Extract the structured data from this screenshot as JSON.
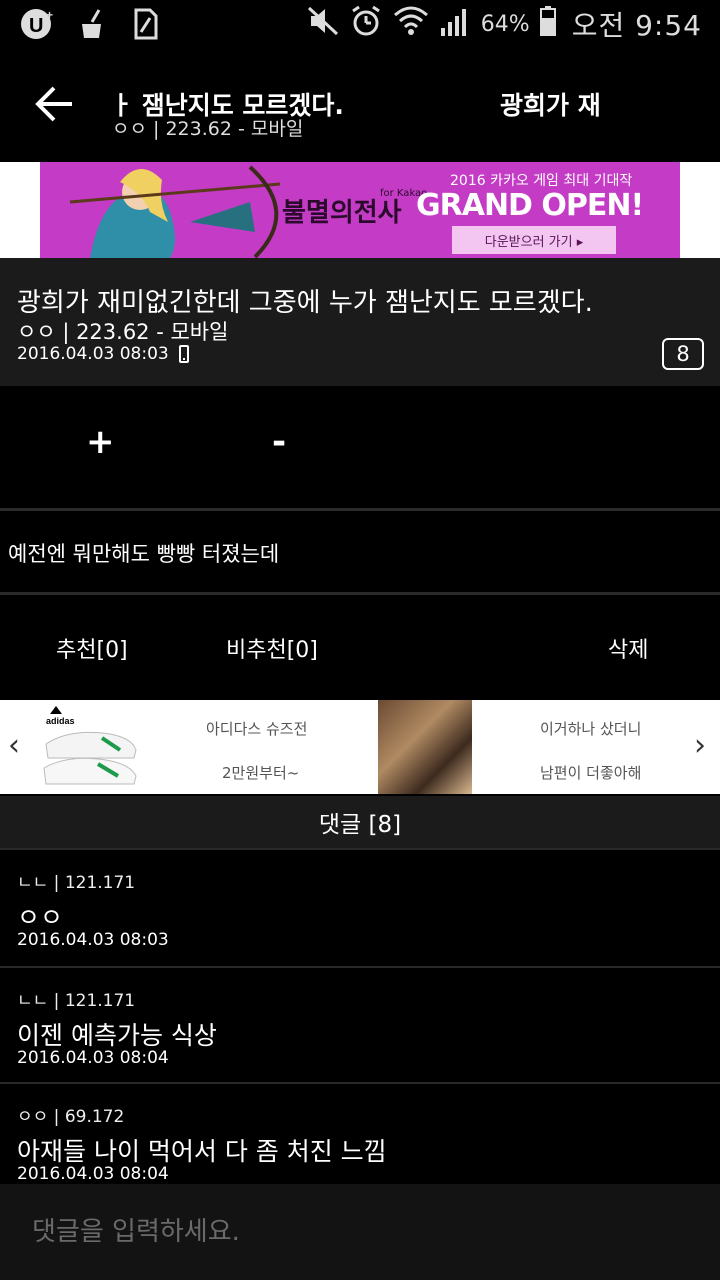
{
  "status_bar": {
    "battery_percent": "64%",
    "time": "오전 9:54",
    "icons": [
      "uplus-icon",
      "broom-icon",
      "sim-icon",
      "mute-icon",
      "alarm-icon",
      "wifi-icon",
      "signal-icon",
      "battery-icon"
    ]
  },
  "topbar": {
    "ticker_line1": "ㅏ 잼난지도 모르겠다.",
    "ticker_line2": "ㅇㅇ | 223.62 - 모바일",
    "ticker_right": "광희가 재"
  },
  "banner": {
    "subtitle": "2016 카카오 게임 최대 기대작",
    "game_title": "불멸의전사",
    "for_kakao": "for Kakao",
    "headline": "GRAND OPEN!",
    "download": "다운받으러 가기 ▸",
    "colors": {
      "bg": "#c43bc6"
    }
  },
  "post": {
    "title": "광희가 재미없긴한데 그중에 누가 잼난지도 모르겠다.",
    "author": "ㅇㅇ | 223.62 - 모바일",
    "date": "2016.04.03 08:03",
    "comment_count": "8",
    "body": "예전엔 뭐만해도 빵빵 터졌는데"
  },
  "vote": {
    "plus": "+",
    "minus": "-"
  },
  "actions": {
    "recommend": "추천[0]",
    "not_recommend": "비추천[0]",
    "delete": "삭제"
  },
  "ads": {
    "left_arrow": "‹",
    "right_arrow": "›",
    "item1_line1": "아디다스 슈즈전",
    "item1_line2": "2만원부터~",
    "item1_brand": "adidas",
    "item2_line1": "이거하나 샀더니",
    "item2_line2": "남편이 더좋아해"
  },
  "comments_header": "댓글 [8]",
  "comments": [
    {
      "author": "ㄴㄴ | 121.171",
      "text": "ㅇㅇ",
      "date": "2016.04.03 08:03"
    },
    {
      "author": "ㄴㄴ | 121.171",
      "text": "이젠 예측가능 식상",
      "date": "2016.04.03 08:04"
    },
    {
      "author": "ㅇㅇ | 69.172",
      "text": "아재들 나이 먹어서 다 좀 처진 느낌",
      "date": "2016.04.03 08:04"
    }
  ],
  "comment_input": {
    "placeholder": "댓글을 입력하세요."
  }
}
